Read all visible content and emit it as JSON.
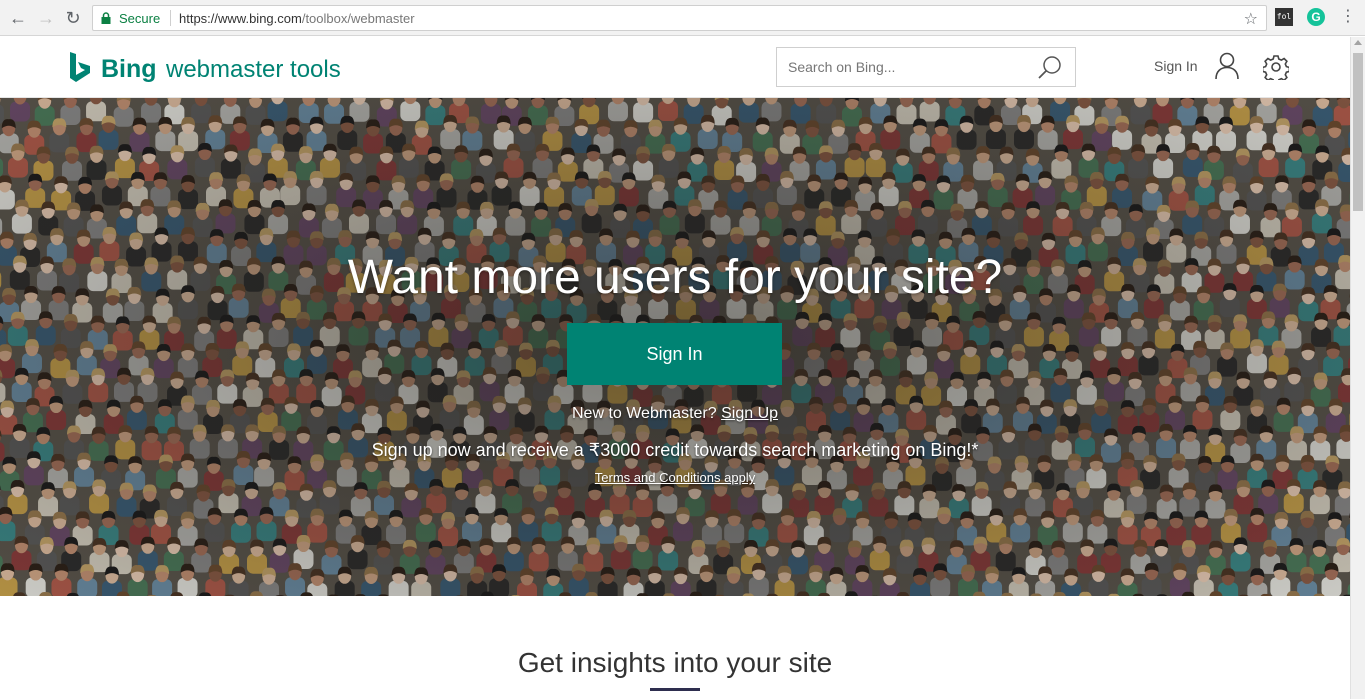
{
  "browser": {
    "secure_label": "Secure",
    "url_host": "https://www.bing.com",
    "url_path": "/toolbox/webmaster",
    "extension_1": "fol",
    "extension_2": "G"
  },
  "header": {
    "brand": "Bing",
    "product": "webmaster tools",
    "search_placeholder": "Search on Bing...",
    "sign_in": "Sign In"
  },
  "hero": {
    "title": "Want more users for your site?",
    "button": "Sign In",
    "new_prefix": "New to Webmaster?",
    "signup": "Sign Up",
    "promo": "Sign up now and receive a ₹3000 credit towards search marketing on Bing!*",
    "terms": "Terms and Conditions apply"
  },
  "section": {
    "title": "Get insights into your site"
  },
  "colors": {
    "accent": "#008373",
    "secure_green": "#0b8043"
  }
}
